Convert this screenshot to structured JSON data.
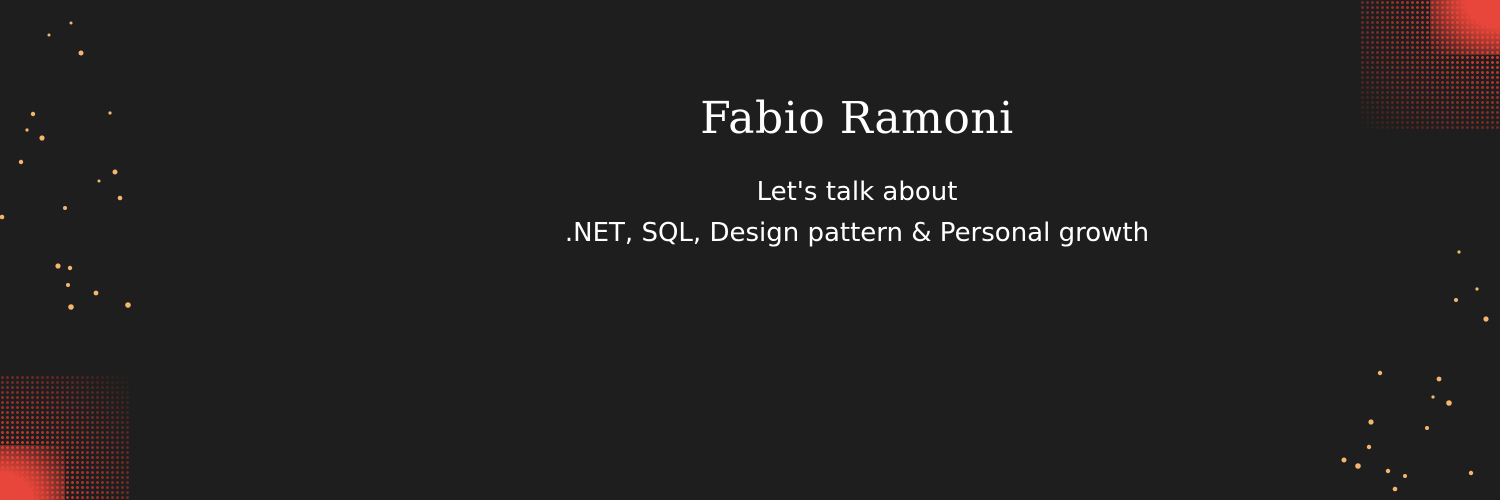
{
  "banner": {
    "name": "Fabio Ramoni",
    "tagline_line1": "Let's talk about",
    "tagline_line2": ".NET, SQL, Design pattern & Personal growth"
  },
  "colors": {
    "background": "#1e1e1e",
    "text": "#ffffff",
    "accent_halftone": "#e23b30",
    "dot": "#f4b56e"
  }
}
